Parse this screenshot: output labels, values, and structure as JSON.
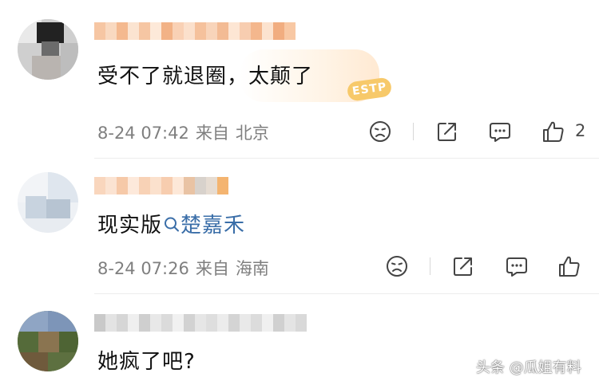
{
  "comments": [
    {
      "text": "受不了就退圈，太颠了",
      "date": "8-24 07:42",
      "from": "来自",
      "location": "北京",
      "likes": "2",
      "badge": "ESTP"
    },
    {
      "text_plain": "现实版",
      "text_link_icon": "search-icon",
      "text_link": "楚嘉禾",
      "date": "8-24 07:26",
      "from": "来自",
      "location": "海南",
      "likes": ""
    },
    {
      "text": "她疯了吧?",
      "date": "",
      "from": "",
      "location": "",
      "likes": ""
    }
  ],
  "actions": {
    "dislike_icon": "sad-face-icon",
    "share_icon": "share-icon",
    "reply_icon": "comment-icon",
    "like_icon": "thumbs-up-icon"
  },
  "colors": {
    "meta_text": "#7f7f7f",
    "link": "#3a6ea8",
    "badge": "#f7c96a"
  },
  "watermark": "头条 @瓜姐有料"
}
